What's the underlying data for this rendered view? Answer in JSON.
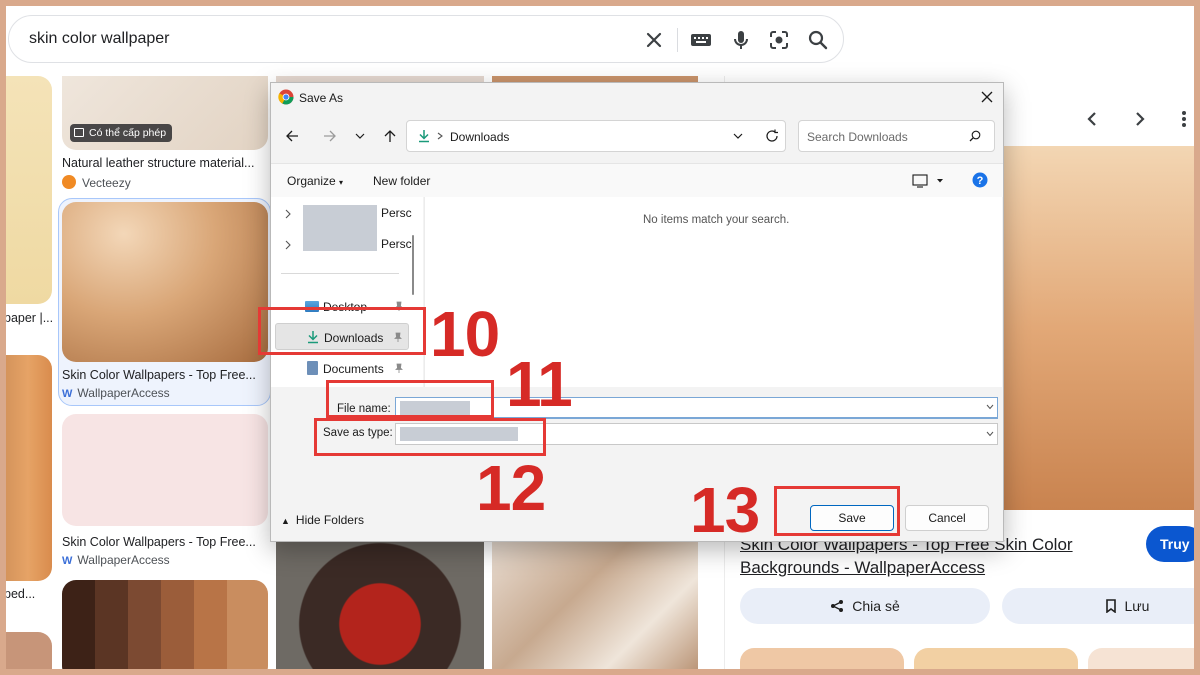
{
  "search": {
    "query": "skin color wallpaper"
  },
  "results": {
    "tile1": {
      "badge": "Có thể cấp phép",
      "caption": "Natural leather structure material...",
      "source": "Vecteezy"
    },
    "tile2": {
      "caption": "Skin Color Wallpapers - Top Free...",
      "source": "WallpaperAccess"
    },
    "tile3": {
      "caption": "Skin Color Wallpapers - Top Free...",
      "source": "WallpaperAccess"
    },
    "left_caption1": "paper |...",
    "left_caption2": "ped..."
  },
  "preview": {
    "title_line1": "Skin Color Wallpapers - Top Free Skin Color",
    "title_line2": "Backgrounds - WallpaperAccess",
    "share_label": "Chia sẻ",
    "save_label": "Lưu",
    "visit_label": "Truy"
  },
  "dialog": {
    "title": "Save As",
    "path": "Downloads",
    "search_placeholder": "Search Downloads",
    "organize_label": "Organize",
    "new_folder_label": "New folder",
    "empty_message": "No items match your search.",
    "nav_items": [
      {
        "label": "Persc"
      },
      {
        "label": "Persc"
      },
      {
        "label": "Desktop"
      },
      {
        "label": "Downloads"
      },
      {
        "label": "Documents"
      }
    ],
    "file_name_label": "File name:",
    "save_as_type_label": "Save as type:",
    "hide_folders_label": "Hide Folders",
    "save_label": "Save",
    "cancel_label": "Cancel"
  },
  "annotations": {
    "step10": "10",
    "step11": "11",
    "step12": "12",
    "step13": "13"
  },
  "colors": {
    "annotation_red": "#e53935",
    "accent_blue": "#0067c0",
    "frame": "#d9a98c"
  }
}
